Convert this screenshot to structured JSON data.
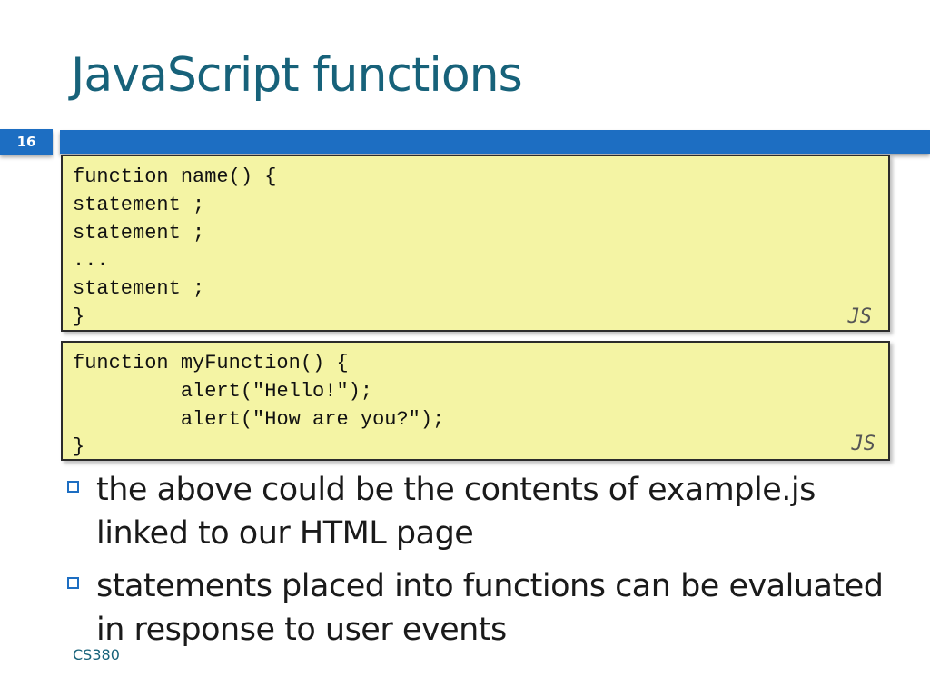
{
  "slide": {
    "title": "JavaScript functions",
    "number": "16",
    "footer": "CS380"
  },
  "code_blocks": [
    {
      "code": "function name() {\nstatement ;\nstatement ;\n...\nstatement ;\n}",
      "language": "JS"
    },
    {
      "code": "function myFunction() {\n\talert(\"Hello!\");\n\talert(\"How are you?\");\n}",
      "language": "JS"
    }
  ],
  "bullets": [
    "the above could be the contents of example.js linked to our HTML page",
    "statements placed into functions can be evaluated in response to user events"
  ],
  "colors": {
    "title": "#17627a",
    "accent_bar": "#1d6ec2",
    "code_background": "#f4f4a4"
  }
}
